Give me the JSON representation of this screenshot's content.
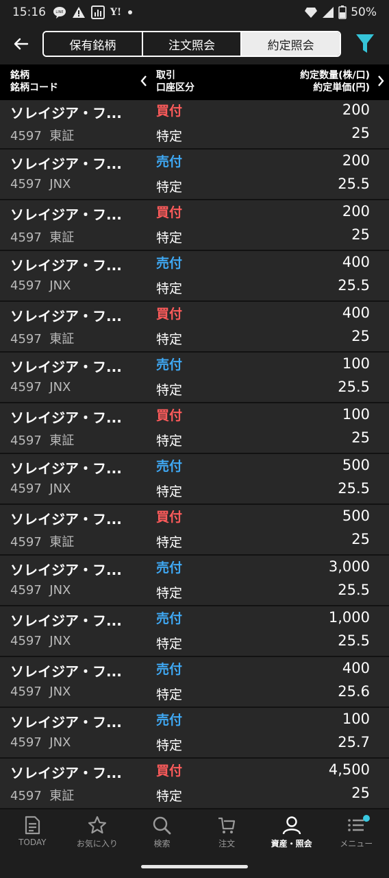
{
  "status": {
    "time": "15:16",
    "battery": "50%",
    "icons": [
      "line-icon",
      "warning-icon",
      "chart-icon",
      "yahoo-icon",
      "dot-icon",
      "diamond-icon",
      "signal-icon",
      "battery-icon"
    ],
    "yahoo_label": "Y!"
  },
  "header": {
    "tabs": [
      "保有銘柄",
      "注文照会",
      "約定照会"
    ],
    "active_tab": "約定照会"
  },
  "columns": {
    "c1_line1": "銘柄",
    "c1_line2": "銘柄コード",
    "c2_line1": "取引",
    "c2_line2": "口座区分",
    "c3_line1": "約定数量(株/口)",
    "c3_line2": "約定単価(円)"
  },
  "rows": [
    {
      "name": "ソレイジア・フ...",
      "code": "4597",
      "market": "東証",
      "side": "買付",
      "account": "特定",
      "qty": "200",
      "price": "25"
    },
    {
      "name": "ソレイジア・フ...",
      "code": "4597",
      "market": "JNX",
      "side": "売付",
      "account": "特定",
      "qty": "200",
      "price": "25.5"
    },
    {
      "name": "ソレイジア・フ...",
      "code": "4597",
      "market": "東証",
      "side": "買付",
      "account": "特定",
      "qty": "200",
      "price": "25"
    },
    {
      "name": "ソレイジア・フ...",
      "code": "4597",
      "market": "JNX",
      "side": "売付",
      "account": "特定",
      "qty": "400",
      "price": "25.5"
    },
    {
      "name": "ソレイジア・フ...",
      "code": "4597",
      "market": "東証",
      "side": "買付",
      "account": "特定",
      "qty": "400",
      "price": "25"
    },
    {
      "name": "ソレイジア・フ...",
      "code": "4597",
      "market": "JNX",
      "side": "売付",
      "account": "特定",
      "qty": "100",
      "price": "25.5"
    },
    {
      "name": "ソレイジア・フ...",
      "code": "4597",
      "market": "東証",
      "side": "買付",
      "account": "特定",
      "qty": "100",
      "price": "25"
    },
    {
      "name": "ソレイジア・フ...",
      "code": "4597",
      "market": "JNX",
      "side": "売付",
      "account": "特定",
      "qty": "500",
      "price": "25.5"
    },
    {
      "name": "ソレイジア・フ...",
      "code": "4597",
      "market": "東証",
      "side": "買付",
      "account": "特定",
      "qty": "500",
      "price": "25"
    },
    {
      "name": "ソレイジア・フ...",
      "code": "4597",
      "market": "JNX",
      "side": "売付",
      "account": "特定",
      "qty": "3,000",
      "price": "25.5"
    },
    {
      "name": "ソレイジア・フ...",
      "code": "4597",
      "market": "JNX",
      "side": "売付",
      "account": "特定",
      "qty": "1,000",
      "price": "25.5"
    },
    {
      "name": "ソレイジア・フ...",
      "code": "4597",
      "market": "JNX",
      "side": "売付",
      "account": "特定",
      "qty": "400",
      "price": "25.6"
    },
    {
      "name": "ソレイジア・フ...",
      "code": "4597",
      "market": "JNX",
      "side": "売付",
      "account": "特定",
      "qty": "100",
      "price": "25.7"
    },
    {
      "name": "ソレイジア・フ...",
      "code": "4597",
      "market": "東証",
      "side": "買付",
      "account": "特定",
      "qty": "4,500",
      "price": "25"
    }
  ],
  "colors": {
    "buy": "#ff5b5b",
    "sell": "#3fa9f5",
    "filter": "#35c4d8",
    "background": "#1e1e1e",
    "row_bg": "#282828"
  },
  "nav": [
    {
      "label": "TODAY",
      "icon": "document-icon",
      "active": false
    },
    {
      "label": "お気に入り",
      "icon": "star-icon",
      "active": false
    },
    {
      "label": "検索",
      "icon": "search-icon",
      "active": false
    },
    {
      "label": "注文",
      "icon": "cart-icon",
      "active": false
    },
    {
      "label": "資産・照会",
      "icon": "person-icon",
      "active": true
    },
    {
      "label": "メニュー",
      "icon": "menu-icon",
      "active": false
    }
  ]
}
